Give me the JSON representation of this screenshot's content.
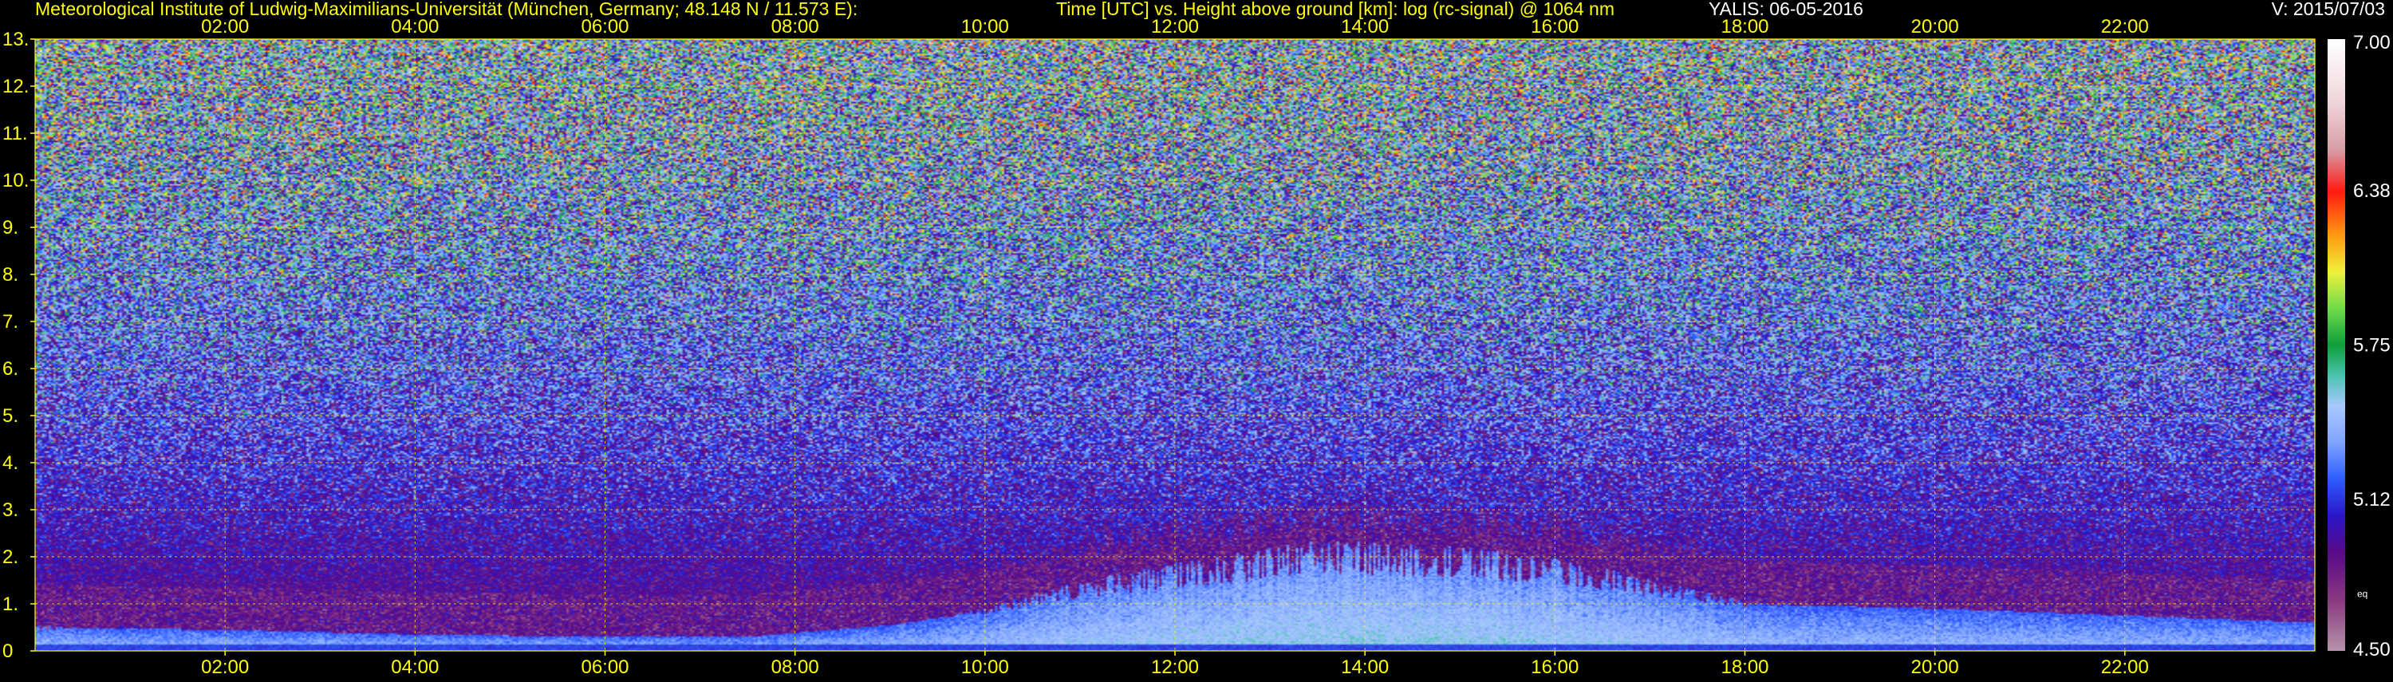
{
  "header": {
    "institute": "Meteorological Institute of Ludwig-Maximilians-Universität (München, Germany; 48.148 N / 11.573 E):",
    "description": "Time [UTC] vs. Height above ground [km]: log (rc-signal) @ 1064 nm",
    "instrument_date": "YALIS: 06-05-2016",
    "version": "V: 2015/07/03"
  },
  "chart_data": {
    "type": "heatmap",
    "title": "Time [UTC] vs. Height above ground [km]: log (rc-signal) @ 1064 nm",
    "x_ticks": [
      "02:00",
      "04:00",
      "06:00",
      "08:00",
      "10:00",
      "12:00",
      "14:00",
      "16:00",
      "18:00",
      "20:00",
      "22:00"
    ],
    "x_tick_hours": [
      2,
      4,
      6,
      8,
      10,
      12,
      14,
      16,
      18,
      20,
      22
    ],
    "xlim_hours": [
      0,
      24
    ],
    "y_ticks": [
      "0",
      "1.",
      "2.",
      "3.",
      "4.",
      "5.",
      "6.",
      "7.",
      "8.",
      "9.",
      "10.",
      "11.",
      "12.",
      "13."
    ],
    "ylim_km": [
      0,
      13
    ],
    "grid": true,
    "colorbar": {
      "range": [
        4.5,
        7.0
      ],
      "labels": [
        "7.00",
        "6.38",
        "5.75",
        "5.12",
        "4.50"
      ],
      "label_values": [
        7.0,
        6.38,
        5.75,
        5.12,
        4.5
      ],
      "extra_label": "eq",
      "stops": [
        {
          "v": 4.5,
          "color": "#b592aa"
        },
        {
          "v": 4.7,
          "color": "#8a3a80"
        },
        {
          "v": 4.9,
          "color": "#5a0a88"
        },
        {
          "v": 5.05,
          "color": "#2b16c8"
        },
        {
          "v": 5.2,
          "color": "#2f5cff"
        },
        {
          "v": 5.35,
          "color": "#7fa4ff"
        },
        {
          "v": 5.5,
          "color": "#a9c8ff"
        },
        {
          "v": 5.62,
          "color": "#4ec4b4"
        },
        {
          "v": 5.75,
          "color": "#0f9e3c"
        },
        {
          "v": 5.9,
          "color": "#6fdc4a"
        },
        {
          "v": 6.05,
          "color": "#f0f03c"
        },
        {
          "v": 6.2,
          "color": "#ff9a10"
        },
        {
          "v": 6.38,
          "color": "#ff1a10"
        },
        {
          "v": 6.55,
          "color": "#d89ca6"
        },
        {
          "v": 6.75,
          "color": "#f0d6dc"
        },
        {
          "v": 7.0,
          "color": "#ffffff"
        }
      ]
    },
    "boundary_layer_top_km": [
      {
        "t": 0,
        "h": 0.5
      },
      {
        "t": 2,
        "h": 0.45
      },
      {
        "t": 4,
        "h": 0.35
      },
      {
        "t": 6,
        "h": 0.3
      },
      {
        "t": 7.5,
        "h": 0.3
      },
      {
        "t": 9,
        "h": 0.55
      },
      {
        "t": 10,
        "h": 0.85
      },
      {
        "t": 11,
        "h": 1.3
      },
      {
        "t": 12,
        "h": 1.6
      },
      {
        "t": 13.5,
        "h": 2.0
      },
      {
        "t": 15,
        "h": 1.9
      },
      {
        "t": 16,
        "h": 1.7
      },
      {
        "t": 17,
        "h": 1.35
      },
      {
        "t": 18,
        "h": 1.0
      },
      {
        "t": 20,
        "h": 0.9
      },
      {
        "t": 22,
        "h": 0.75
      },
      {
        "t": 24,
        "h": 0.6
      }
    ]
  },
  "colors": {
    "background": "#000000",
    "header_text": "#ffff00",
    "axis_text": "#ffff00",
    "grid": "#ffff00",
    "version_text": "#ffffff",
    "colorbar_text": "#ffffff"
  }
}
